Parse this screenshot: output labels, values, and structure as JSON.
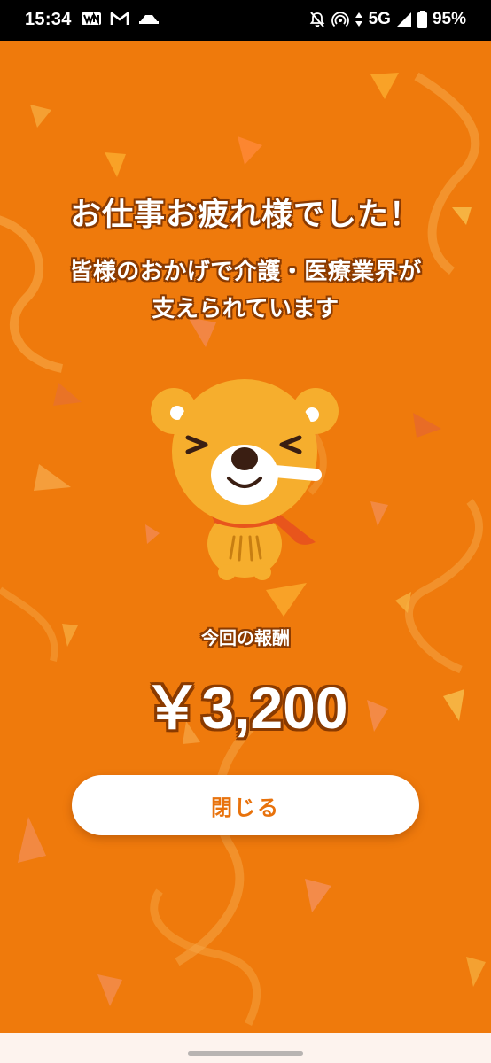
{
  "status_bar": {
    "time": "15:34",
    "network": "5G",
    "battery": "95%",
    "left_icons": [
      "wnl-icon",
      "gmail-icon",
      "app-notification-icon"
    ],
    "right_icons": [
      "notifications-off-icon",
      "hotspot-icon",
      "data-arrows-icon",
      "signal-icon",
      "battery-icon"
    ]
  },
  "completion": {
    "title": "お仕事お疲れ様でした！",
    "subtitle_line1": "皆様のおかげで介護・医療業界が",
    "subtitle_line2": "支えられています",
    "reward_label": "今回の報酬",
    "reward_amount": "￥3,200",
    "close_button_label": "閉じる"
  },
  "mascot": {
    "name": "bear-mascot-icon"
  },
  "colors": {
    "background": "#ef7a0c",
    "text_outline": "#8a3a00",
    "button_bg": "#ffffff",
    "button_text": "#e8720c",
    "mascot_body": "#f6ae2d",
    "scarf": "#e8551c"
  }
}
